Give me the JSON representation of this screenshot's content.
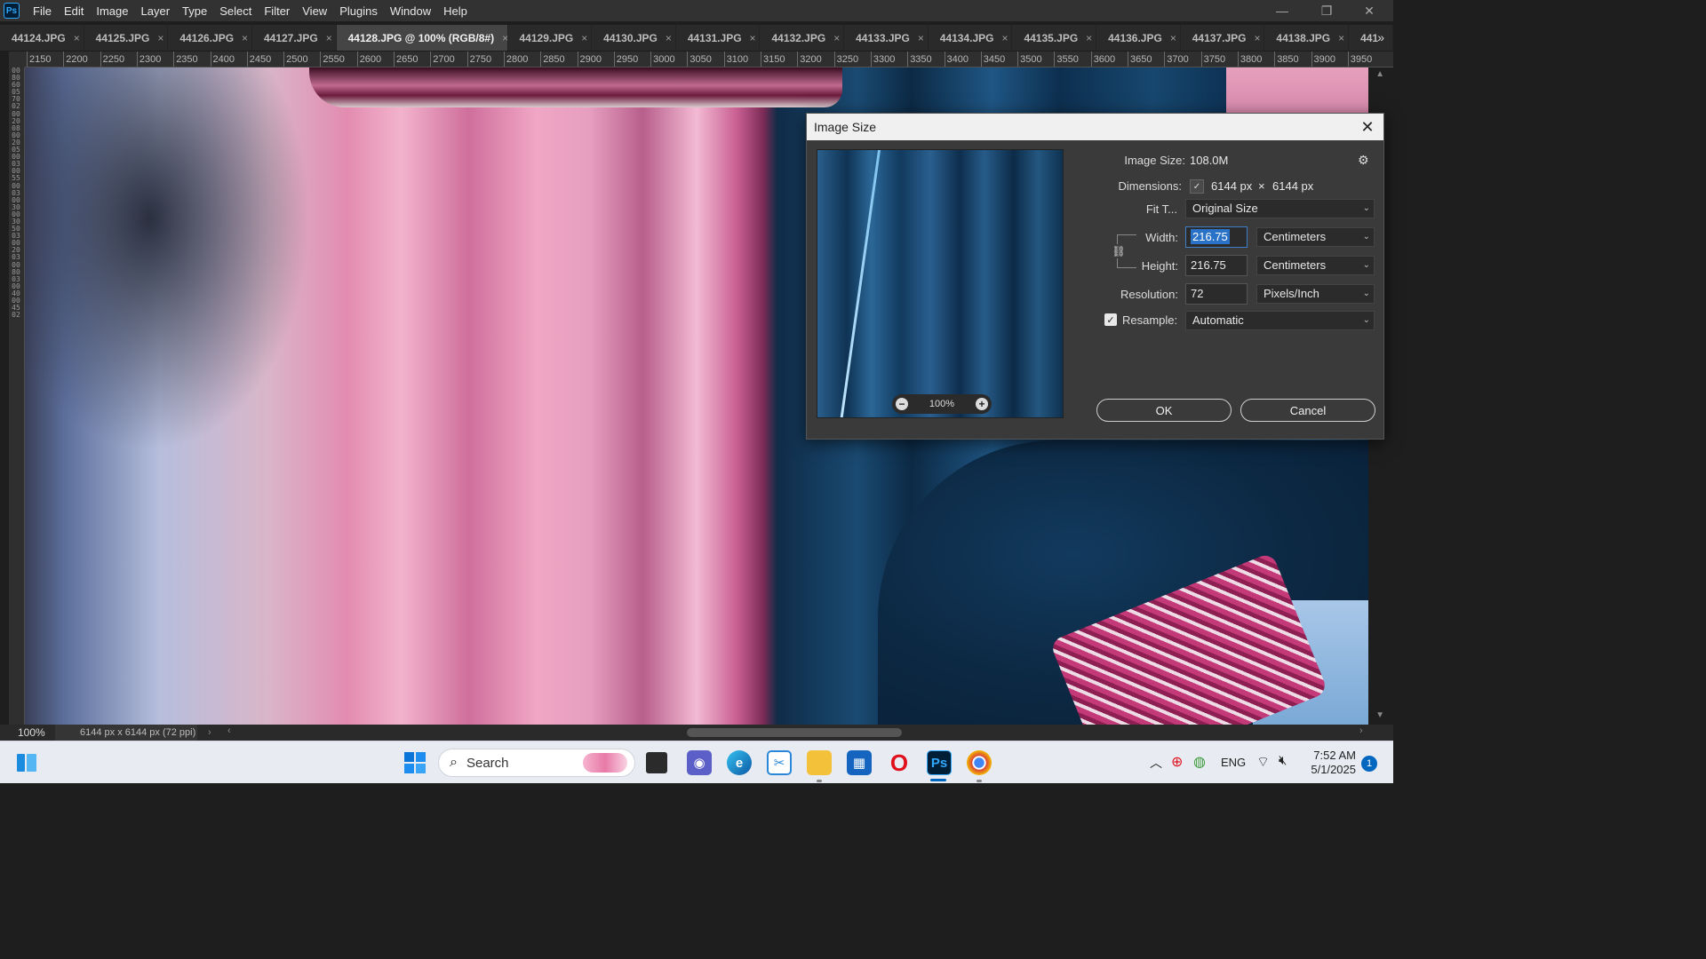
{
  "app": {
    "logo": "Ps",
    "menu": [
      "File",
      "Edit",
      "Image",
      "Layer",
      "Type",
      "Select",
      "Filter",
      "View",
      "Plugins",
      "Window",
      "Help"
    ],
    "window_controls": {
      "minimize": "—",
      "restore": "❐",
      "close": "✕"
    }
  },
  "tabs": [
    {
      "label": "44124.JPG",
      "active": false
    },
    {
      "label": "44125.JPG",
      "active": false
    },
    {
      "label": "44126.JPG",
      "active": false
    },
    {
      "label": "44127.JPG",
      "active": false
    },
    {
      "label": "44128.JPG @ 100% (RGB/8#)",
      "active": true
    },
    {
      "label": "44129.JPG",
      "active": false
    },
    {
      "label": "44130.JPG",
      "active": false
    },
    {
      "label": "44131.JPG",
      "active": false
    },
    {
      "label": "44132.JPG",
      "active": false
    },
    {
      "label": "44133.JPG",
      "active": false
    },
    {
      "label": "44134.JPG",
      "active": false
    },
    {
      "label": "44135.JPG",
      "active": false
    },
    {
      "label": "44136.JPG",
      "active": false
    },
    {
      "label": "44137.JPG",
      "active": false
    },
    {
      "label": "44138.JPG",
      "active": false
    },
    {
      "label": "441",
      "active": false
    }
  ],
  "tab_close_glyph": "×",
  "tab_overflow": "»",
  "ruler": {
    "top_labels": [
      "2150",
      "2200",
      "2250",
      "2300",
      "2350",
      "2400",
      "2450",
      "2500",
      "2550",
      "2600",
      "2650",
      "2700",
      "2750",
      "2800",
      "2850",
      "2900",
      "2950",
      "3000",
      "3050",
      "3100",
      "3150",
      "3200",
      "3250",
      "3300",
      "3350",
      "3400",
      "3450",
      "3500",
      "3550",
      "3600",
      "3650",
      "3700",
      "3750",
      "3800",
      "3850",
      "3900",
      "3950"
    ],
    "left_digits": "0080600570020020080020050003005500030030003050030020030080030040004502"
  },
  "status": {
    "zoom": "100%",
    "doc_info": "6144 px x 6144 px (72 ppi)",
    "arrow": "›"
  },
  "dialog": {
    "title": "Image Size",
    "close_glyph": "✕",
    "gear_glyph": "⚙",
    "preview_zoom": "100%",
    "zoom_out": "−",
    "zoom_in": "+",
    "image_size_label": "Image Size:",
    "image_size_value": "108.0M",
    "dimensions_label": "Dimensions:",
    "dimensions_width": "6144 px",
    "dimensions_x": "×",
    "dimensions_height": "6144 px",
    "fit_label": "Fit T...",
    "fit_value": "Original Size",
    "width_label": "Width:",
    "width_value": "216.75",
    "width_unit": "Centimeters",
    "height_label": "Height:",
    "height_value": "216.75",
    "height_unit": "Centimeters",
    "resolution_label": "Resolution:",
    "resolution_value": "72",
    "resolution_unit": "Pixels/Inch",
    "resample_label": "Resample:",
    "resample_checked": true,
    "resample_value": "Automatic",
    "ok_label": "OK",
    "cancel_label": "Cancel",
    "link_glyph": "⛓",
    "check_glyph": "✓",
    "caret_glyph": "⌄"
  },
  "taskbar": {
    "search_placeholder": "Search",
    "tray_language": "ENG",
    "time": "7:52 AM",
    "date": "5/1/2025",
    "notification_count": "1",
    "icons": [
      "windows-start-icon",
      "widgets-icon",
      "task-view-icon",
      "teams-icon",
      "edge-icon",
      "snipping-tool-icon",
      "file-explorer-icon",
      "microsoft-store-icon",
      "opera-icon",
      "photoshop-icon",
      "chrome-icon"
    ],
    "photoshop_label": "Ps"
  },
  "colors": {
    "accent_blue": "#2a72c7",
    "photoshop_blue": "#31a8ff",
    "taskbar_active": "#0067c0"
  }
}
